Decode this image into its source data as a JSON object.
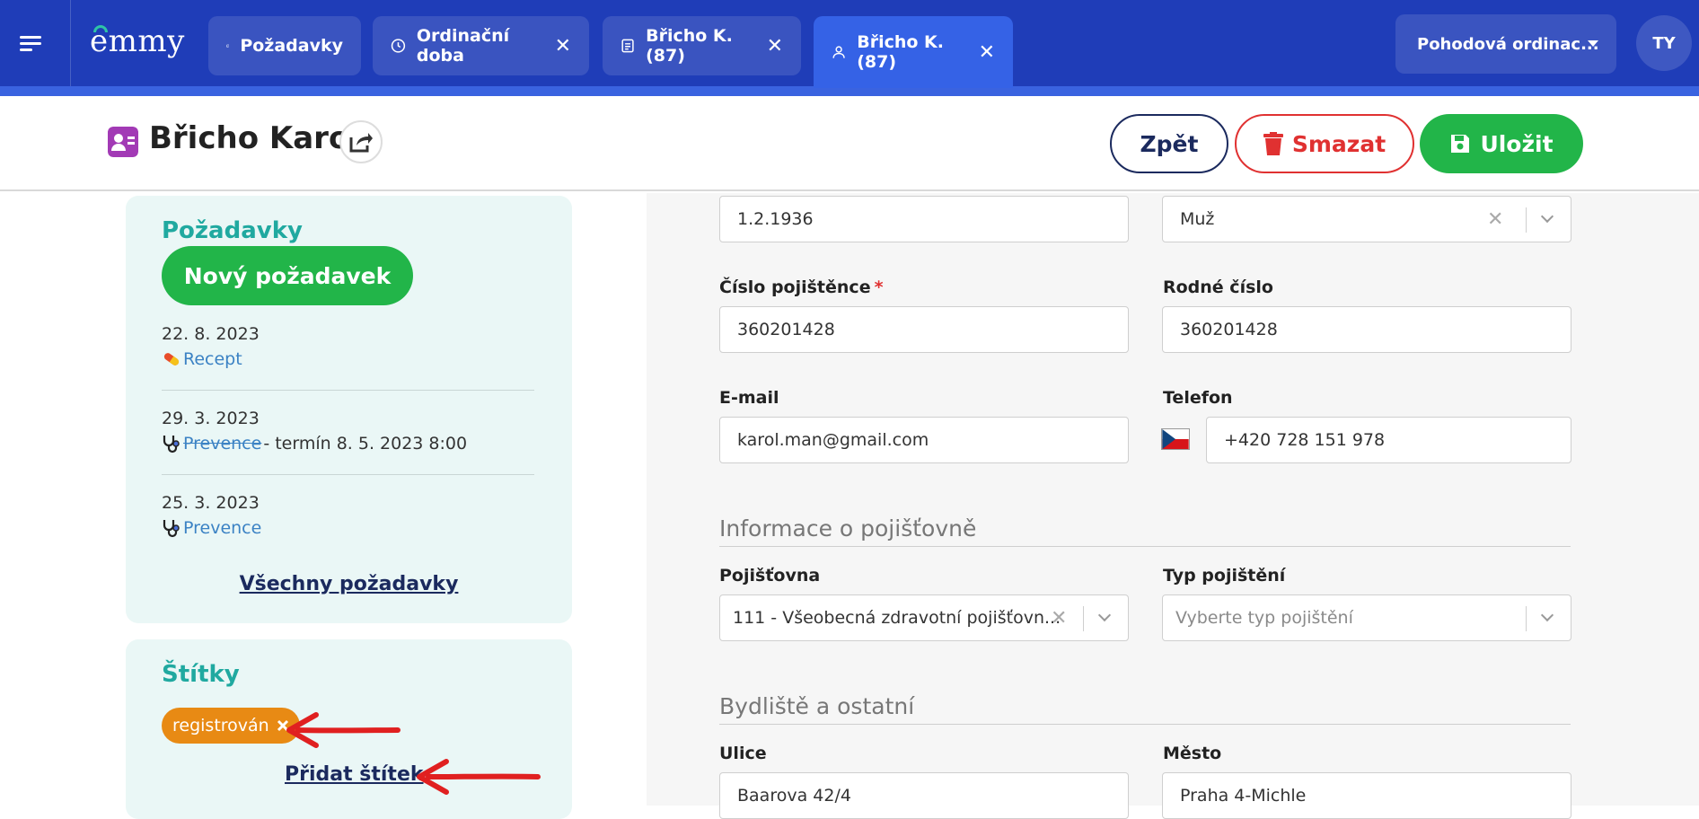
{
  "topbar": {
    "logo": "emmy",
    "tabs": [
      {
        "label": "Požadavky",
        "icon": "document-stack-icon",
        "closable": false
      },
      {
        "label": "Ordinační doba",
        "icon": "clock-icon",
        "closable": true
      },
      {
        "label": "Břicho K. (87)",
        "icon": "document-icon",
        "closable": true
      },
      {
        "label": "Břicho K. (87)",
        "icon": "person-icon",
        "closable": true,
        "active": true
      }
    ],
    "close_glyph": "✕",
    "clinic": "Pohodová ordinac...",
    "user_initials": "TY"
  },
  "header": {
    "patient_name": "Břicho Karol",
    "back_label": "Zpět",
    "delete_label": "Smazat",
    "save_label": "Uložit"
  },
  "requests_panel": {
    "title": "Požadavky",
    "new_button": "Nový požadavek",
    "items": [
      {
        "date": "22. 8. 2023",
        "type": "Recept",
        "icon": "pill-icon",
        "suffix": ""
      },
      {
        "date": "29. 3. 2023",
        "type": "Prevence",
        "icon": "stethoscope-icon",
        "suffix": " - termín 8. 5. 2023 8:00",
        "struck": true
      },
      {
        "date": "25. 3. 2023",
        "type": "Prevence",
        "icon": "stethoscope-icon",
        "suffix": ""
      }
    ],
    "all_link": "Všechny požadavky"
  },
  "tags_panel": {
    "title": "Štítky",
    "tags": [
      {
        "label": "registrován"
      }
    ],
    "add_link": "Přidat štítek"
  },
  "form": {
    "birth_date": "1.2.1936",
    "gender": "Muž",
    "insurance_number": {
      "label": "Číslo pojištěnce",
      "required_mark": "*",
      "value": "360201428"
    },
    "birth_number": {
      "label": "Rodné číslo",
      "value": "360201428"
    },
    "email": {
      "label": "E-mail",
      "value": "karol.man@gmail.com"
    },
    "phone": {
      "label": "Telefon",
      "value": "+420 728 151 978"
    },
    "insurance_section": "Informace o pojišťovně",
    "insurer": {
      "label": "Pojišťovna",
      "value": "111 - Všeobecná zdravotní pojišťovn..."
    },
    "insurance_type": {
      "label": "Typ pojištění",
      "placeholder": "Vyberte typ pojištění"
    },
    "residence_section": "Bydliště a ostatní",
    "street": {
      "label": "Ulice",
      "value": "Baarova 42/4"
    },
    "city": {
      "label": "Město",
      "value": "Praha 4-Michle"
    }
  },
  "colors": {
    "topbar": "#1f3db8",
    "active_tab": "#3562e6",
    "accent_green": "#22b549",
    "danger": "#e03131",
    "teal_title": "#20a9a0",
    "tag_orange": "#e88a14",
    "annotation_arrow": "#e02020"
  }
}
